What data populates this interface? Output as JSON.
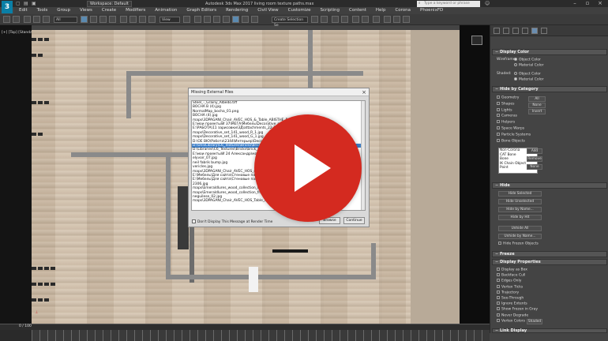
{
  "titlebar": {
    "workspace": "Workspace: Default",
    "app_title": "Autodesk 3ds Max 2017    living room texture paths.max",
    "search_placeholder": "Type a keyword or phrase"
  },
  "menu": [
    "Edit",
    "Tools",
    "Group",
    "Views",
    "Create",
    "Modifiers",
    "Animation",
    "Graph Editors",
    "Rendering",
    "Civil View",
    "Customize",
    "Scripting",
    "Content",
    "Help",
    "Corona",
    "PhoenixFD"
  ],
  "toolbar": {
    "selection_filter": "All",
    "view": "View",
    "selection_set": "Create Selection Se"
  },
  "viewport": {
    "label": "[+] [Top] [Standard] [Default Shading]"
  },
  "dialog": {
    "title": "Missing External Files",
    "files": [
      "Steel_-_Grainy_Albedo.tiff",
      "BOCHA B (4).jpg",
      "NormalMap_bocha_01.png",
      "BOCHA (4).jpg",
      "maps\\3DPAGANI_Chair_AVEC_HOS_&_Table_ABISTHE_Fab_03.jpg",
      "E:\\мои проекты\\И 37\\МЕГА\\Мебель\\Decorative_set_141_wood_Ol_gl.png",
      "E:\\РАБОТА\\11 зарисовки\\3Д\\attachments_22-10-2016\\Decorative_2.jpg",
      "maps\\Decorative_set_141_wood_R_1.jpg",
      "maps\\Decorative_set_141_wood_G_1.jpg",
      "D:\\ОЕ ВЮ\\Работа\\2344\\Интерьер\\Decorative_set_1.jpg",
      "D:\\UnivLibrary\\C6_Textures\\Bricks\\brick_07.jpg",
      "D:\\Libraries\\C6_Textures\\Bricks\\brick_07_bump.jpg",
      "E:\\мои проекты\\И 24 Александр\\материалы\\textura_42.jpg",
      "elyvoir_07.jpg",
      "neil fabrik bump.jpg",
      "vericles.jpg",
      "maps\\3DPAGANI_Chair_AVEC_HOS_&_Table_ABISTHE_fabric_Normal.jpg",
      "E:\\Мебель\\Для сайта\\Стеновые панели\\Panel_4_1.jpg",
      "E:\\Мебель\\Для сайта\\Стеновые панели\\Panel_4_2.jpg",
      "2306.jpg",
      "maps\\Emeraldlures_wood_collection_Morphel.jpg",
      "maps\\Emeraldlures_wood_collection_front.jpg",
      "neguilese_02.jpg",
      "maps\\3DPAGANI_Chair_AVEC_HOS_Table_fab.jpg"
    ],
    "selected_index": 10,
    "checkbox_label": "Don't Display This Message at Render Time",
    "buttons": [
      "Browse",
      "Continue"
    ]
  },
  "command_panel": {
    "display_color": {
      "title": "Display Color",
      "wireframe_label": "Wireframe:",
      "shaded_label": "Shaded:",
      "opt_object": "Object Color",
      "opt_material": "Material Color"
    },
    "hide_by_category": {
      "title": "Hide by Category",
      "items": [
        "Geometry",
        "Shapes",
        "Lights",
        "Cameras",
        "Helpers",
        "Space Warps",
        "Particle Systems",
        "Bone Objects"
      ],
      "btn_all": "All",
      "btn_none": "None",
      "btn_invert": "Invert",
      "list": [
        "Non-Corona",
        "CAT Bone",
        "Bone",
        "IK Chain Object",
        "Point"
      ],
      "btn_add": "Add",
      "btn_remove": "Remove",
      "btn_none2": "None"
    },
    "hide": {
      "title": "Hide",
      "buttons": [
        "Hide Selected",
        "Hide Unselected",
        "Hide by Name...",
        "Hide by Hit",
        "Unhide All",
        "Unhide by Name...",
        "Hide Frozen Objects"
      ]
    },
    "freeze": {
      "title": "Freeze"
    },
    "display_properties": {
      "title": "Display Properties",
      "items": [
        "Display as Box",
        "Backface Cull",
        "Edges Only",
        "Vertex Ticks",
        "Trajectory",
        "See-Through",
        "Ignore Extents",
        "Show Frozen in Gray",
        "Never Degrade",
        "Vertex Colors"
      ],
      "shaded_btn": "Shaded"
    },
    "link_display": {
      "title": "Link Display"
    }
  },
  "timeline": {
    "frame": "0 / 100"
  }
}
